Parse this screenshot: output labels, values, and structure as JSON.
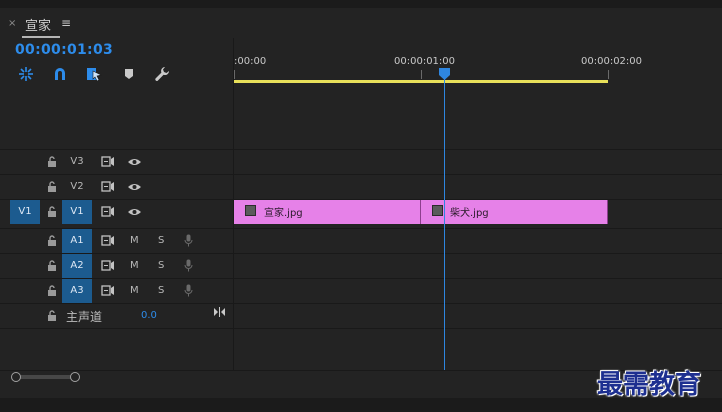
{
  "tab": {
    "title": "宣家",
    "close": "×",
    "menu": "≡"
  },
  "timecode": "00:00:01:03",
  "tools": [
    "nest-sequence-icon",
    "snap-magnet-icon",
    "linked-selection-icon",
    "add-marker-icon",
    "wrench-settings-icon"
  ],
  "ruler": {
    "labels": [
      ":00:00",
      "00:00:01:00",
      "00:00:02:00"
    ]
  },
  "tracks": {
    "video": [
      {
        "name": "V3",
        "active": false
      },
      {
        "name": "V2",
        "active": false
      },
      {
        "name": "V1",
        "active": true,
        "source": "V1"
      }
    ],
    "audio": [
      {
        "name": "A1",
        "active": true,
        "m": "M",
        "s": "S"
      },
      {
        "name": "A2",
        "active": true,
        "m": "M",
        "s": "S"
      },
      {
        "name": "A3",
        "active": true,
        "m": "M",
        "s": "S"
      }
    ],
    "master": {
      "label": "主声道",
      "value": "0.0"
    }
  },
  "clips": [
    {
      "name": "宣家.jpg"
    },
    {
      "name": "柴犬.jpg"
    }
  ],
  "watermark": "最需教育",
  "colors": {
    "accent": "#2d8ceb",
    "clip": "#e681e8",
    "workarea": "#e8e05a",
    "track_active": "#1c5b8f"
  }
}
